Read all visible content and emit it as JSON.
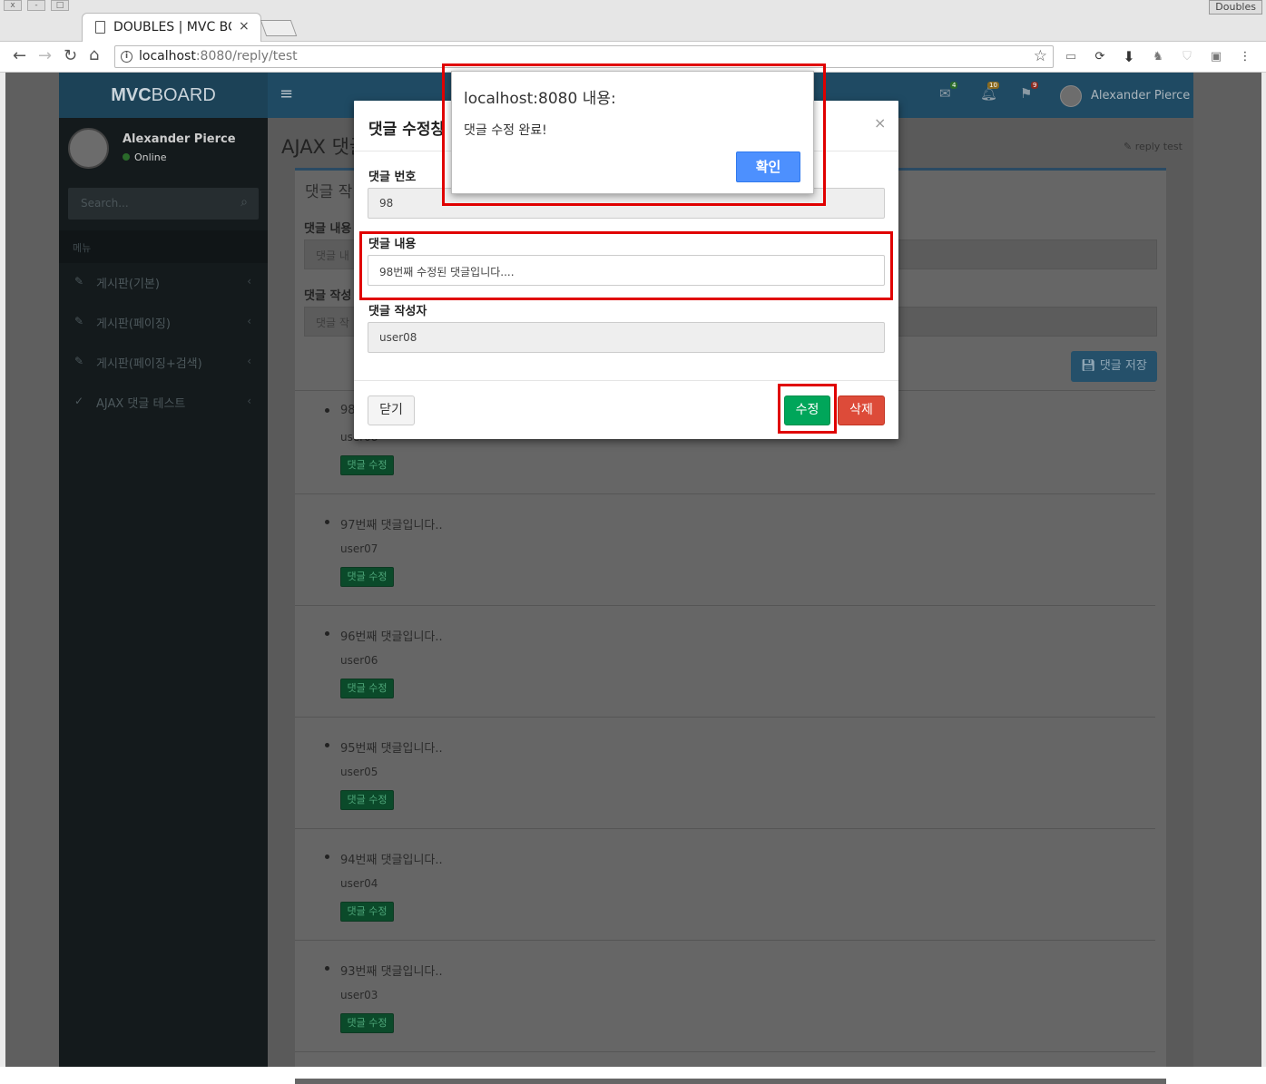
{
  "browser": {
    "tab_title": "DOUBLES | MVC BOARD",
    "tab_close": "×",
    "profile_name": "Doubles",
    "url_host": "localhost",
    "url_rest": ":8080/reply/test",
    "info_icon": "i"
  },
  "header": {
    "logo_bold": "MVC",
    "logo_rest": "BOARD",
    "menu_icon": "≡",
    "messages_badge": "4",
    "notifications_badge": "10",
    "tasks_badge": "9",
    "user_name": "Alexander Pierce"
  },
  "sidebar": {
    "user_name": "Alexander Pierce",
    "status": "Online",
    "search_placeholder": "Search...",
    "menu_header": "메뉴",
    "items": [
      {
        "label": "게시판(기본)"
      },
      {
        "label": "게시판(페이징)"
      },
      {
        "label": "게시판(페이징+검색)"
      },
      {
        "label": "AJAX 댓글 테스트"
      }
    ]
  },
  "content": {
    "title": "AJAX 댓글",
    "breadcrumb": "reply test",
    "box_title": "댓글 작",
    "label_text": "댓글 내용",
    "placeholder_text": "댓글 내",
    "label_writer": "댓글 작성",
    "placeholder_writer": "댓글 작",
    "save_button": "댓글 저장"
  },
  "replies": [
    {
      "text": "98",
      "user": "user08",
      "button": "댓글 수정"
    },
    {
      "text": "97번째 댓글입니다..",
      "user": "user07",
      "button": "댓글 수정"
    },
    {
      "text": "96번째 댓글입니다..",
      "user": "user06",
      "button": "댓글 수정"
    },
    {
      "text": "95번째 댓글입니다..",
      "user": "user05",
      "button": "댓글 수정"
    },
    {
      "text": "94번째 댓글입니다..",
      "user": "user04",
      "button": "댓글 수정"
    },
    {
      "text": "93번째 댓글입니다..",
      "user": "user03",
      "button": "댓글 수정"
    }
  ],
  "modal": {
    "title": "댓글 수정창",
    "close_icon": "×",
    "label_no": "댓글 번호",
    "value_no": "98",
    "label_text": "댓글 내용",
    "value_text": "98번째 수정된 댓글입니다....",
    "label_writer": "댓글 작성자",
    "value_writer": "user08",
    "btn_close": "닫기",
    "btn_modify": "수정",
    "btn_delete": "삭제"
  },
  "alert": {
    "title": "localhost:8080 내용:",
    "message": "댓글 수정 완료!",
    "ok": "확인"
  },
  "colors": {
    "highlight": "#e00000",
    "modify_button": "#00a65a",
    "delete_button": "#dd4b39",
    "alert_ok": "#4d90fe"
  }
}
